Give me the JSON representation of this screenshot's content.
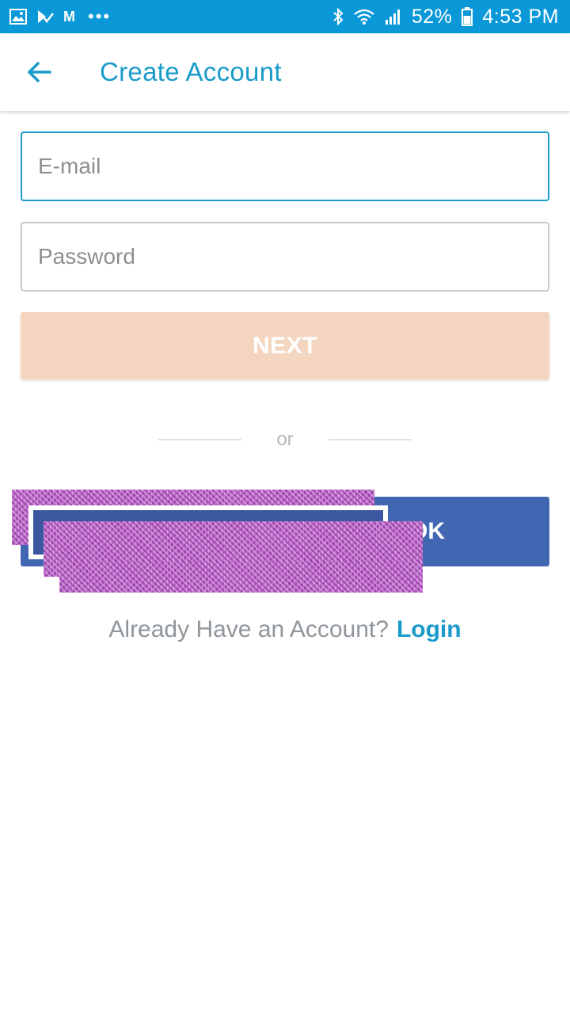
{
  "status_bar": {
    "battery": "52%",
    "time": "4:53 PM",
    "notification_icons": [
      "image-icon",
      "checklist-icon",
      "gmail-icon",
      "more-icon"
    ],
    "system_icons": [
      "bluetooth-icon",
      "wifi-icon",
      "signal-icon",
      "battery-icon"
    ],
    "gmail_letter": "M",
    "more": "•••"
  },
  "app_bar": {
    "title": "Create Account",
    "back_icon": "arrow-left-icon"
  },
  "form": {
    "email_placeholder": "E-mail",
    "password_placeholder": "Password",
    "next_label": "NEXT"
  },
  "divider": {
    "text": "or"
  },
  "facebook": {
    "label_visible": "OK"
  },
  "login": {
    "prompt": "Already Have an Account?",
    "link": "Login"
  },
  "colors": {
    "status_bar": "#0a98d8",
    "accent": "#1a9bc9",
    "next_button_disabled": "#f4d6c0",
    "facebook_blue": "#4267b2"
  }
}
